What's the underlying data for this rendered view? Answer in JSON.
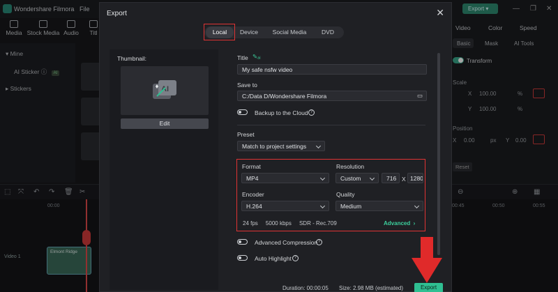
{
  "app": {
    "title": "Wondershare Filmora",
    "menu_file": "File",
    "top_export": "Export",
    "toolbar_tabs": [
      "Media",
      "Stock Media",
      "Audio",
      "Titl"
    ],
    "left_items": [
      "Mine",
      "AI Sticker",
      "Stickers"
    ],
    "ai_badge": "AI",
    "right_tabs": [
      "Video",
      "Color",
      "Speed"
    ],
    "right_subtabs": [
      "Basic",
      "Mask",
      "AI Tools"
    ],
    "transform": "Transform",
    "scale": "Scale",
    "scale_x": "100.00",
    "scale_y": "100.00",
    "pct": "%",
    "position": "Position",
    "pos_x": "0.00",
    "pos_y": "0.00",
    "px": "px",
    "x": "X",
    "y": "Y",
    "reset": "Reset",
    "times": [
      "00:00",
      "00:45",
      "00:50",
      "00:55"
    ],
    "clip_label": "Elmont Ridge",
    "track": "Video 1"
  },
  "dialog": {
    "title": "Export",
    "tabs": [
      "Local",
      "Device",
      "Social Media",
      "DVD"
    ],
    "active_tab": "Local",
    "thumbnail_label": "Thumbnail:",
    "edit": "Edit",
    "title_label": "Title",
    "title_value": "My safe nsfw video",
    "save_to_label": "Save to",
    "save_to_value": "C:/Data D/Wondershare Filmora",
    "backup_label": "Backup to the Cloud",
    "preset_label": "Preset",
    "preset_value": "Match to project settings",
    "format_label": "Format",
    "format_value": "MP4",
    "resolution_label": "Resolution",
    "resolution_value": "Custom",
    "res_width": "716",
    "res_x": "X",
    "res_height": "1280",
    "encoder_label": "Encoder",
    "encoder_value": "H.264",
    "quality_label": "Quality",
    "quality_value": "Medium",
    "fps": "24 fps",
    "bitrate": "5000 kbps",
    "color": "SDR - Rec.709",
    "advanced": "Advanced",
    "advanced_compression": "Advanced Compression",
    "auto_highlight": "Auto Highlight",
    "duration": "Duration: 00:00:05",
    "size": "Size:  2.98 MB (estimated)",
    "export": "Export"
  },
  "colors": {
    "accent": "#2fbf92",
    "highlight_red": "#e03434"
  }
}
